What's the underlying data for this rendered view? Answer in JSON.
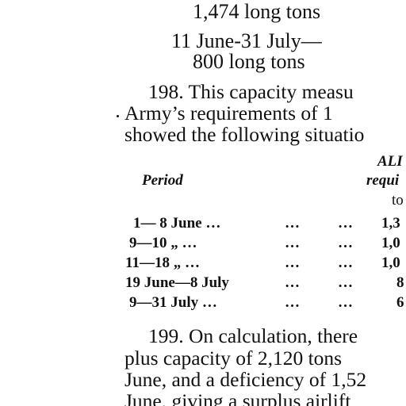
{
  "capacity_lines": [
    "1,474 long tons",
    "11 June-31 July—",
    "800 long tons"
  ],
  "paragraph_198": [
    "198. This capacity measu",
    "Army’s requirements of 1",
    "showed the following situatio"
  ],
  "table": {
    "header_period": "Period",
    "header_req_line1": "ALI",
    "header_req_line2": "requi",
    "header_req_line3": "to",
    "rows": [
      {
        "period": "1— 8 June …",
        "d1": "…",
        "d2": "…",
        "value": "1,3"
      },
      {
        "period": "9—10 „ …",
        "d1": "…",
        "d2": "…",
        "value": "1,0"
      },
      {
        "period": "11—18 „ …",
        "d1": "…",
        "d2": "…",
        "value": "1,0"
      },
      {
        "period": "19 June—8 July",
        "d1": "…",
        "d2": "…",
        "value": "8"
      },
      {
        "period": "9—31 July …",
        "d1": "…",
        "d2": "…",
        "value": "6"
      }
    ]
  },
  "paragraph_199": [
    "199. On calculation, there",
    "plus capacity of 2,120 tons",
    "June, and a deficiency of 1,52",
    "June, giving a surplus airlift"
  ]
}
